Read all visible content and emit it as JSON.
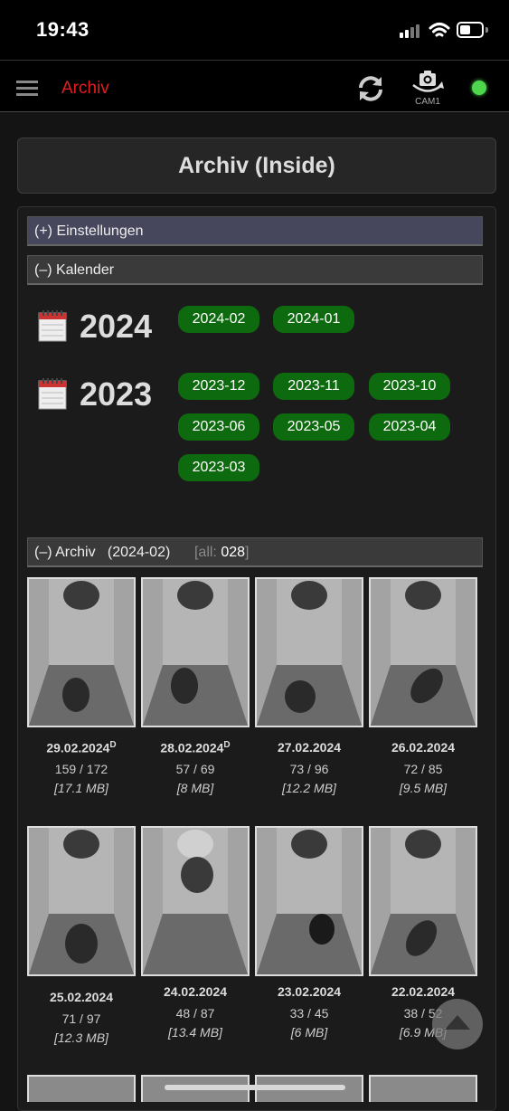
{
  "status_bar": {
    "time": "19:43"
  },
  "topbar": {
    "title": "Archiv",
    "camera_label": "CAM1",
    "connection_color": "#4fd64f"
  },
  "page_title": "Archiv (Inside)",
  "sections": {
    "settings": "(+) Einstellungen",
    "calendar": "(–) Kalender",
    "archive_toggle": "(–) Archiv",
    "archive_period": "(2024-02)",
    "archive_all_label": "[all:",
    "archive_all_count": "028",
    "archive_all_close": "]"
  },
  "calendar": {
    "years": [
      {
        "year": "2024",
        "months": [
          "2024-02",
          "2024-01"
        ]
      },
      {
        "year": "2023",
        "months": [
          "2023-12",
          "2023-11",
          "2023-10",
          "2023-06",
          "2023-05",
          "2023-04",
          "2023-03"
        ]
      }
    ]
  },
  "archive_items": [
    {
      "date": "29.02.2024",
      "mark": "D",
      "counts": "159 / 172",
      "size": "[17.1 MB]"
    },
    {
      "date": "28.02.2024",
      "mark": "D",
      "counts": "57 / 69",
      "size": "[8 MB]"
    },
    {
      "date": "27.02.2024",
      "mark": "",
      "counts": "73 / 96",
      "size": "[12.2 MB]"
    },
    {
      "date": "26.02.2024",
      "mark": "",
      "counts": "72 / 85",
      "size": "[9.5 MB]"
    },
    {
      "date": "25.02.2024",
      "mark": "",
      "counts": "71 / 97",
      "size": "[12.3 MB]"
    },
    {
      "date": "24.02.2024",
      "mark": "",
      "counts": "48 / 87",
      "size": "[13.4 MB]"
    },
    {
      "date": "23.02.2024",
      "mark": "",
      "counts": "33 / 45",
      "size": "[6 MB]"
    },
    {
      "date": "22.02.2024",
      "mark": "",
      "counts": "38 / 52",
      "size": "[6.9 MB]"
    }
  ],
  "icons": {
    "menu": "hamburger-icon",
    "refresh": "refresh-icon",
    "camera_switch": "camera-switch-icon",
    "calendar": "calendar-icon",
    "scroll_top": "arrow-up-icon"
  }
}
